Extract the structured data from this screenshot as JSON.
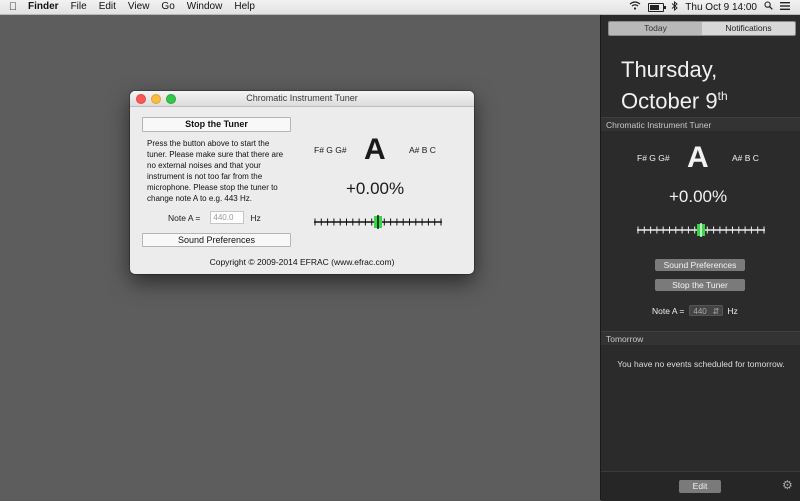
{
  "menubar": {
    "apple_icon": "apple-logo-icon",
    "app_name": "Finder",
    "menus": [
      "File",
      "Edit",
      "View",
      "Go",
      "Window",
      "Help"
    ],
    "clock": "Thu Oct 9  14:00",
    "status_icons": [
      "wifi-icon",
      "battery-icon",
      "bluetooth-icon",
      "search-icon",
      "list-icon"
    ]
  },
  "window": {
    "title": "Chromatic Instrument Tuner",
    "stop_button": "Stop the Tuner",
    "instructions": "Press the button above to start the tuner. Please make sure that there are no external noises and that your instrument is not too far from the microphone. Please stop the tuner to change note A to e.g. 443 Hz.",
    "note_a_label": "Note A =",
    "note_a_value": "440.0",
    "hz_label": "Hz",
    "sound_prefs_button": "Sound Preferences",
    "copyright": "Copyright © 2009-2014 EFRAC (www.efrac.com)",
    "tuner": {
      "low_notes": "F# G G#",
      "note": "A",
      "high_notes": "A# B C",
      "cents": "+0.00%",
      "deviation": 0
    }
  },
  "notification_center": {
    "tabs": [
      "Today",
      "Notifications"
    ],
    "date_line1": "Thursday,",
    "date_line2": "October 9",
    "date_suffix": "th",
    "widget_title": "Chromatic Instrument Tuner",
    "tuner": {
      "low_notes": "F# G G#",
      "note": "A",
      "high_notes": "A# B C",
      "cents": "+0.00%",
      "deviation": 0
    },
    "sound_prefs_button": "Sound Preferences",
    "stop_button": "Stop the Tuner",
    "note_a_label": "Note A =",
    "note_a_value": "440",
    "hz_label": "Hz",
    "tomorrow_header": "Tomorrow",
    "tomorrow_text": "You have no events scheduled for tomorrow.",
    "edit_button": "Edit"
  },
  "colors": {
    "meter_green": "#39d44a",
    "close": "#fc5753",
    "minimize": "#fdbc40",
    "zoom": "#34c84a"
  }
}
